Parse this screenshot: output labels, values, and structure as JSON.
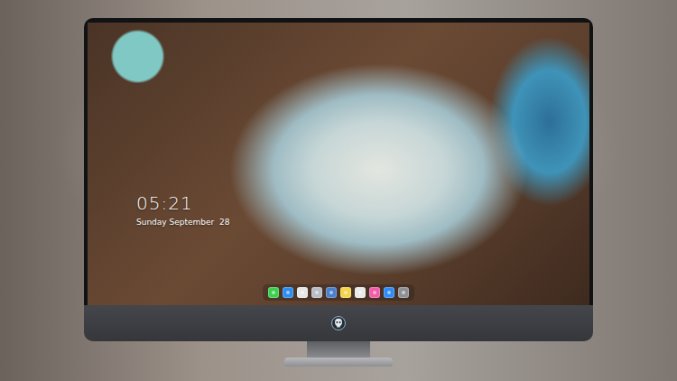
{
  "lock_screen": {
    "time": "05:21",
    "date": "Sunday September  28"
  },
  "dock": {
    "items": [
      {
        "color": "#3ccf4e"
      },
      {
        "color": "#2b8ef0"
      },
      {
        "color": "#e6e6e6"
      },
      {
        "color": "#b8bcc4"
      },
      {
        "color": "#4a7fc9"
      },
      {
        "color": "#f5d547"
      },
      {
        "color": "#e9e9e9"
      },
      {
        "color": "#f25ca8"
      },
      {
        "color": "#2f8cf5"
      },
      {
        "color": "#8d9096"
      }
    ]
  }
}
